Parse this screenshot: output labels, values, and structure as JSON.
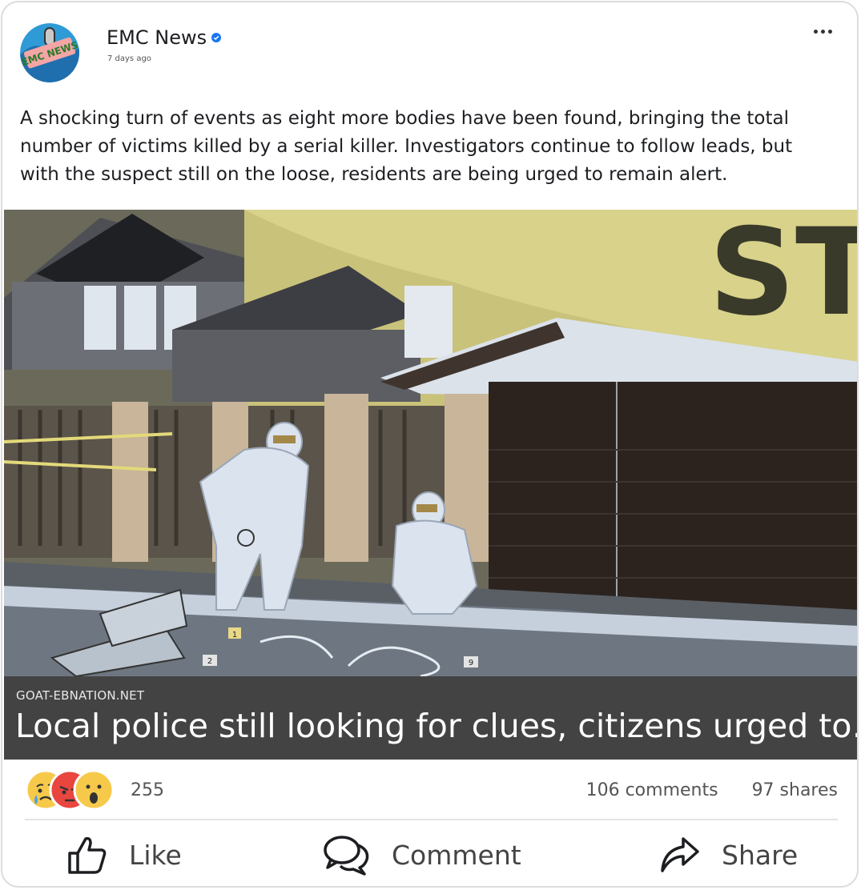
{
  "post": {
    "page_name": "EMC News",
    "verified_icon": "verified-badge-icon",
    "timestamp": "7 days ago",
    "text": "A shocking turn of events as eight more bodies have been found, bringing the total number of victims killed by a serial killer. Investigators continue to follow leads, but with the suspect still on the loose, residents are being urged to remain alert.",
    "avatar_text": "EMC NEWS"
  },
  "link": {
    "domain": "GOAT-EBNATION.NET",
    "headline": "Local police still looking for clues, citizens urged to…",
    "image_signs": [
      "1",
      "2",
      "9"
    ],
    "image_sign_text": "ST"
  },
  "engagement": {
    "reaction_icons": [
      "sad-reaction-icon",
      "angry-reaction-icon",
      "wow-reaction-icon"
    ],
    "reaction_count": "255",
    "comments": "106 comments",
    "shares": "97 shares"
  },
  "actions": {
    "like": "Like",
    "comment": "Comment",
    "share": "Share"
  },
  "colors": {
    "accent": "#1877f2",
    "link_bar": "#444343"
  }
}
